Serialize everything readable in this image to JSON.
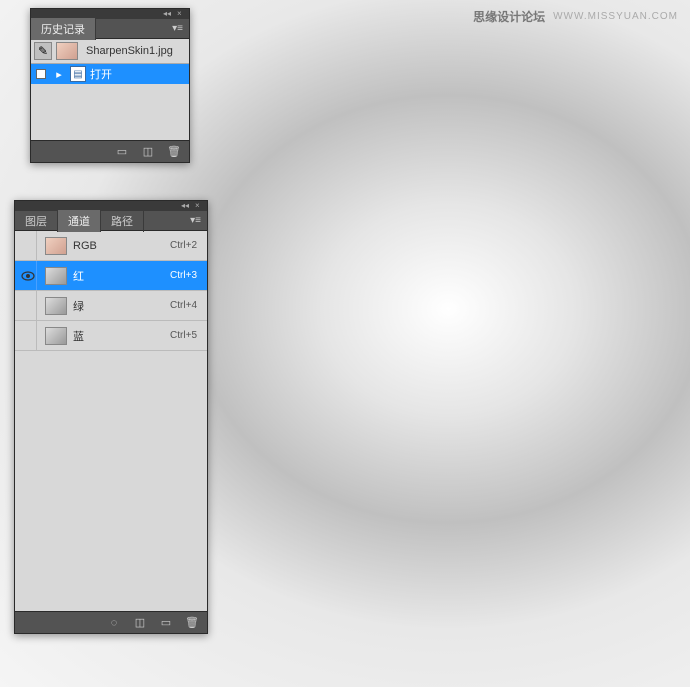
{
  "watermark": {
    "main": "思缘设计论坛",
    "url": "WWW.MISSYUAN.COM"
  },
  "history_panel": {
    "tab_label": "历史记录",
    "filename": "SharpenSkin1.jpg",
    "items": [
      {
        "label": "打开",
        "selected": true
      }
    ]
  },
  "channels_panel": {
    "tabs": [
      "图层",
      "通道",
      "路径"
    ],
    "active_tab": 1,
    "channels": [
      {
        "name": "RGB",
        "shortcut": "Ctrl+2",
        "visible": false,
        "selected": false
      },
      {
        "name": "红",
        "shortcut": "Ctrl+3",
        "visible": true,
        "selected": true
      },
      {
        "name": "绿",
        "shortcut": "Ctrl+4",
        "visible": false,
        "selected": false
      },
      {
        "name": "蓝",
        "shortcut": "Ctrl+5",
        "visible": false,
        "selected": false
      }
    ]
  }
}
